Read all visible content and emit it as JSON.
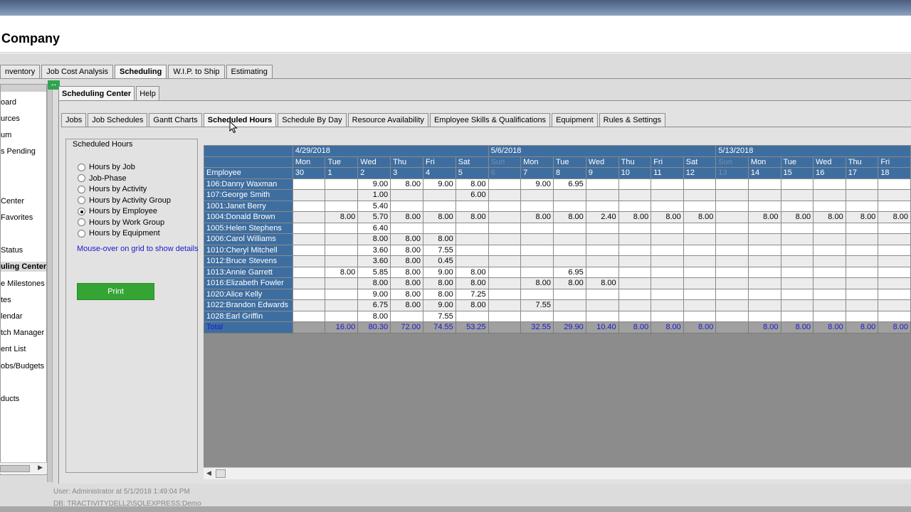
{
  "app": {
    "company": "Company"
  },
  "main_tabs": [
    {
      "label": "nventory",
      "active": false
    },
    {
      "label": "Job Cost Analysis",
      "active": false
    },
    {
      "label": "Scheduling",
      "active": true
    },
    {
      "label": "W.I.P. to Ship",
      "active": false
    },
    {
      "label": "Estimating",
      "active": false
    }
  ],
  "sidebar": {
    "items": [
      {
        "label": "oard"
      },
      {
        "label": "urces"
      },
      {
        "label": "um"
      },
      {
        "label": "s Pending"
      },
      {
        "label": "Center"
      },
      {
        "label": "Favorites"
      },
      {
        "label": "Status"
      },
      {
        "label": "uling Center"
      },
      {
        "label": "e Milestones"
      },
      {
        "label": "tes"
      },
      {
        "label": "lendar"
      },
      {
        "label": "tch Manager"
      },
      {
        "label": "ent List"
      },
      {
        "label": "obs/Budgets"
      },
      {
        "label": "ducts"
      }
    ]
  },
  "sub_tabs": [
    {
      "label": "Scheduling Center",
      "active": true
    },
    {
      "label": "Help",
      "active": false
    }
  ],
  "scheduling_tabs": [
    {
      "label": "Jobs",
      "active": false
    },
    {
      "label": "Job Schedules",
      "active": false
    },
    {
      "label": "Gantt Charts",
      "active": false
    },
    {
      "label": "Scheduled Hours",
      "active": true
    },
    {
      "label": "Schedule By Day",
      "active": false
    },
    {
      "label": "Resource Availability",
      "active": false
    },
    {
      "label": "Employee Skills & Qualifications",
      "active": false
    },
    {
      "label": "Equipment",
      "active": false
    },
    {
      "label": "Rules & Settings",
      "active": false
    }
  ],
  "options": {
    "group_title": "Scheduled Hours",
    "radios": [
      {
        "label": "Hours by Job",
        "checked": false
      },
      {
        "label": "Job-Phase",
        "checked": false
      },
      {
        "label": "Hours by Activity",
        "checked": false
      },
      {
        "label": "Hours by Activity Group",
        "checked": false
      },
      {
        "label": "Hours by Employee",
        "checked": true
      },
      {
        "label": "Hours by Work Group",
        "checked": false
      },
      {
        "label": "Hours by Equipment",
        "checked": false
      }
    ],
    "hint": "Mouse-over on grid to show details",
    "print_label": "Print"
  },
  "grid": {
    "employee_header": "Employee",
    "weeks": [
      {
        "label": "4/29/2018",
        "span": 6
      },
      {
        "label": "5/6/2018",
        "span": 7
      },
      {
        "label": "5/13/2018",
        "span": 6
      }
    ],
    "days": [
      {
        "dow": "Mon",
        "num": "30",
        "dim": false
      },
      {
        "dow": "Tue",
        "num": "1",
        "dim": false
      },
      {
        "dow": "Wed",
        "num": "2",
        "dim": false
      },
      {
        "dow": "Thu",
        "num": "3",
        "dim": false
      },
      {
        "dow": "Fri",
        "num": "4",
        "dim": false
      },
      {
        "dow": "Sat",
        "num": "5",
        "dim": false
      },
      {
        "dow": "Sun",
        "num": "6",
        "dim": true
      },
      {
        "dow": "Mon",
        "num": "7",
        "dim": false
      },
      {
        "dow": "Tue",
        "num": "8",
        "dim": false
      },
      {
        "dow": "Wed",
        "num": "9",
        "dim": false
      },
      {
        "dow": "Thu",
        "num": "10",
        "dim": false
      },
      {
        "dow": "Fri",
        "num": "11",
        "dim": false
      },
      {
        "dow": "Sat",
        "num": "12",
        "dim": false
      },
      {
        "dow": "Sun",
        "num": "13",
        "dim": true
      },
      {
        "dow": "Mon",
        "num": "14",
        "dim": false
      },
      {
        "dow": "Tue",
        "num": "15",
        "dim": false
      },
      {
        "dow": "Wed",
        "num": "16",
        "dim": false
      },
      {
        "dow": "Thu",
        "num": "17",
        "dim": false
      },
      {
        "dow": "Fri",
        "num": "18",
        "dim": false
      }
    ],
    "rows": [
      {
        "employee": "106:Danny Waxman",
        "values": [
          "",
          "",
          "9.00",
          "8.00",
          "9.00",
          "8.00",
          "",
          "9.00",
          "6.95",
          "",
          "",
          "",
          "",
          "",
          "",
          "",
          "",
          "",
          ""
        ]
      },
      {
        "employee": "107:George Smith",
        "values": [
          "",
          "",
          "1.00",
          "",
          "",
          "6.00",
          "",
          "",
          "",
          "",
          "",
          "",
          "",
          "",
          "",
          "",
          "",
          "",
          ""
        ]
      },
      {
        "employee": "1001:Janet Berry",
        "values": [
          "",
          "",
          "5.40",
          "",
          "",
          "",
          "",
          "",
          "",
          "",
          "",
          "",
          "",
          "",
          "",
          "",
          "",
          "",
          ""
        ]
      },
      {
        "employee": "1004:Donald Brown",
        "values": [
          "",
          "8.00",
          "5.70",
          "8.00",
          "8.00",
          "8.00",
          "",
          "8.00",
          "8.00",
          "2.40",
          "8.00",
          "8.00",
          "8.00",
          "",
          "8.00",
          "8.00",
          "8.00",
          "8.00",
          "8.00"
        ]
      },
      {
        "employee": "1005:Helen Stephens",
        "values": [
          "",
          "",
          "6.40",
          "",
          "",
          "",
          "",
          "",
          "",
          "",
          "",
          "",
          "",
          "",
          "",
          "",
          "",
          "",
          ""
        ]
      },
      {
        "employee": "1006:Carol Williams",
        "values": [
          "",
          "",
          "8.00",
          "8.00",
          "8.00",
          "",
          "",
          "",
          "",
          "",
          "",
          "",
          "",
          "",
          "",
          "",
          "",
          "",
          ""
        ]
      },
      {
        "employee": "1010:Cheryl Mitchell",
        "values": [
          "",
          "",
          "3.60",
          "8.00",
          "7.55",
          "",
          "",
          "",
          "",
          "",
          "",
          "",
          "",
          "",
          "",
          "",
          "",
          "",
          ""
        ]
      },
      {
        "employee": "1012:Bruce Stevens",
        "values": [
          "",
          "",
          "3.60",
          "8.00",
          "0.45",
          "",
          "",
          "",
          "",
          "",
          "",
          "",
          "",
          "",
          "",
          "",
          "",
          "",
          ""
        ]
      },
      {
        "employee": "1013:Annie Garrett",
        "values": [
          "",
          "8.00",
          "5.85",
          "8.00",
          "9.00",
          "8.00",
          "",
          "",
          "6.95",
          "",
          "",
          "",
          "",
          "",
          "",
          "",
          "",
          "",
          ""
        ]
      },
      {
        "employee": "1016:Elizabeth Fowler",
        "values": [
          "",
          "",
          "8.00",
          "8.00",
          "8.00",
          "8.00",
          "",
          "8.00",
          "8.00",
          "8.00",
          "",
          "",
          "",
          "",
          "",
          "",
          "",
          "",
          ""
        ]
      },
      {
        "employee": "1020:Alice Kelly",
        "values": [
          "",
          "",
          "9.00",
          "8.00",
          "8.00",
          "7.25",
          "",
          "",
          "",
          "",
          "",
          "",
          "",
          "",
          "",
          "",
          "",
          "",
          ""
        ]
      },
      {
        "employee": "1022:Brandon Edwards",
        "values": [
          "",
          "",
          "6.75",
          "8.00",
          "9.00",
          "8.00",
          "",
          "7.55",
          "",
          "",
          "",
          "",
          "",
          "",
          "",
          "",
          "",
          "",
          ""
        ]
      },
      {
        "employee": "1028:Earl Griffin",
        "values": [
          "",
          "",
          "8.00",
          "",
          "7.55",
          "",
          "",
          "",
          "",
          "",
          "",
          "",
          "",
          "",
          "",
          "",
          "",
          "",
          ""
        ]
      }
    ],
    "total": {
      "label": "Total",
      "values": [
        "",
        "16.00",
        "80.30",
        "72.00",
        "74.55",
        "53.25",
        "",
        "32.55",
        "29.90",
        "10.40",
        "8.00",
        "8.00",
        "8.00",
        "",
        "8.00",
        "8.00",
        "8.00",
        "8.00",
        "8.00"
      ]
    }
  },
  "status": {
    "user_line": "User: Administrator at 5/1/2018 1:49:04 PM",
    "db_line": "DB: TRACTIVITYDELL2\\SQLEXPRESS:Demo"
  },
  "colors": {
    "grid_header": "#3e6ea0",
    "print_button": "#34a534",
    "hint_text": "#1a1acc"
  }
}
